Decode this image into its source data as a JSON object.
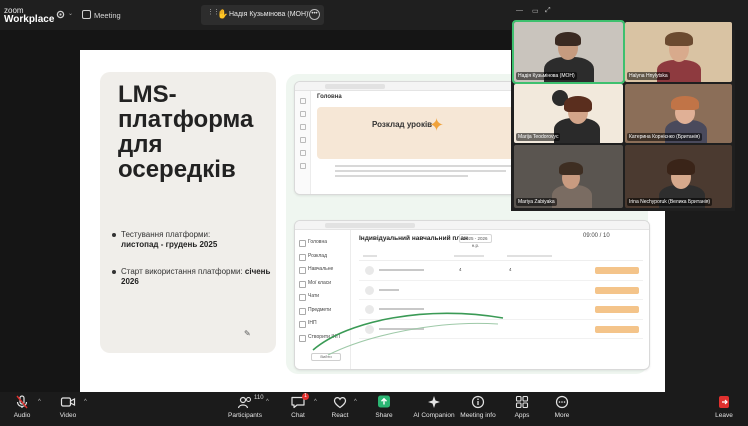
{
  "app": {
    "brand_line1": "zoom",
    "brand_line2": "Workplace",
    "meeting_label": "Meeting"
  },
  "share_indicator": {
    "text": "Надія Кузьмінова (МОН)'s scree"
  },
  "slide": {
    "title": "LMS-\nплатформа\nдля\nосередків",
    "bullet1_label": "Тестування платформи:",
    "bullet1_value": "листопад - грудень 2025",
    "bullet2_label": "Старт використання платформи:",
    "bullet2_value": "січень 2026"
  },
  "mockup_top": {
    "heading": "Головна",
    "banner_title": "Розклад уроків"
  },
  "mockup_bottom": {
    "sidebar": [
      "Головна",
      "Розклад",
      "Навчальне",
      "Мої класи",
      "Чати",
      "Предмети",
      "ІНП",
      "Створити ІНП"
    ],
    "sidebar_button": "Вийти",
    "title": "Індивідуальний навчальний план",
    "select_value": "2025 - 2026 н.р.",
    "time": "09:00 / 10",
    "rows": [
      {
        "n1": "4",
        "n2": "4"
      },
      {
        "n1": "",
        "n2": ""
      },
      {
        "n1": "",
        "n2": ""
      },
      {
        "n1": "",
        "n2": ""
      }
    ]
  },
  "participants": [
    {
      "name": "Надія Кузьмінова (МОН)"
    },
    {
      "name": "Halyna Hnylytska"
    },
    {
      "name": "Marija Teodorovyc"
    },
    {
      "name": "Катерина Корнієнко (Британія)"
    },
    {
      "name": "Mariya Zabiyaka"
    },
    {
      "name": "Irina Nechyporuk (Велика Британія)"
    }
  ],
  "toolbar": {
    "audio": "Audio",
    "video": "Video",
    "participants": "Participants",
    "participants_count": "110",
    "chat": "Chat",
    "chat_badge": "1",
    "react": "React",
    "share": "Share",
    "ai_companion": "AI Companion",
    "meeting_info": "Meeting info",
    "apps": "Apps",
    "more": "More",
    "leave": "Leave"
  },
  "colors": {
    "share_green": "#2bb673",
    "leave_red": "#e0302e",
    "slide_accent": "#f0a23a",
    "mock_button": "#f4c48a"
  }
}
